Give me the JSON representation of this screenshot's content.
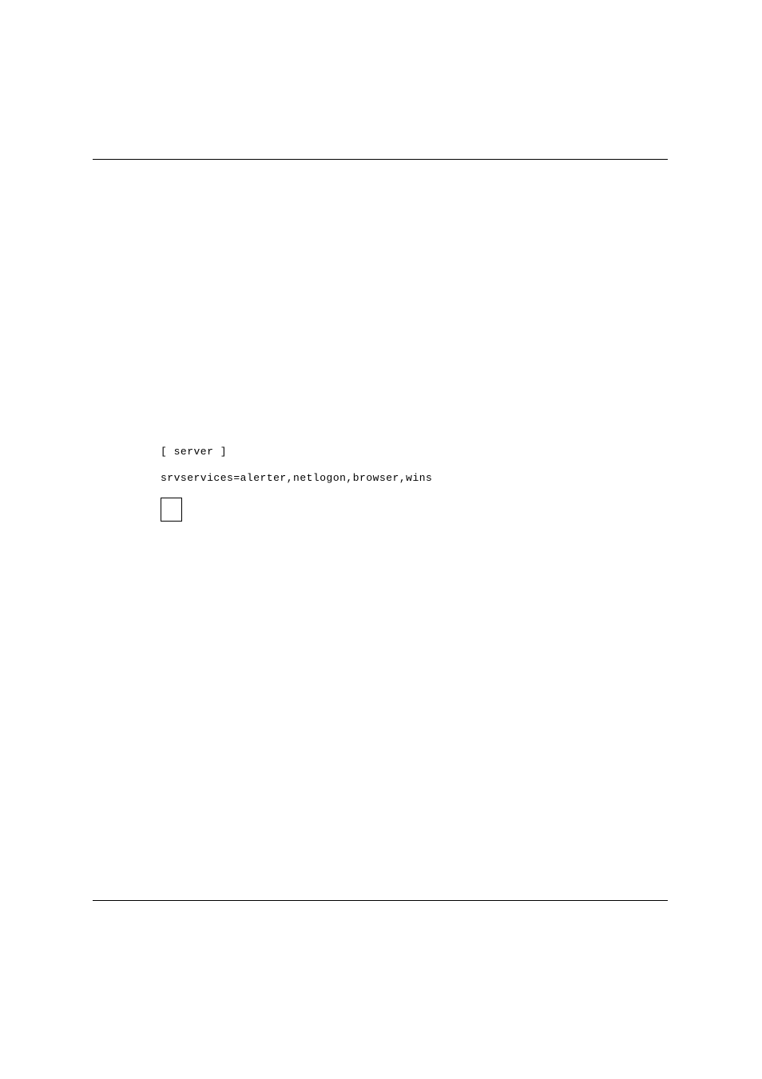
{
  "code": {
    "line1": "[ server ]",
    "line2": "srvservices=alerter,netlogon,browser,wins"
  }
}
